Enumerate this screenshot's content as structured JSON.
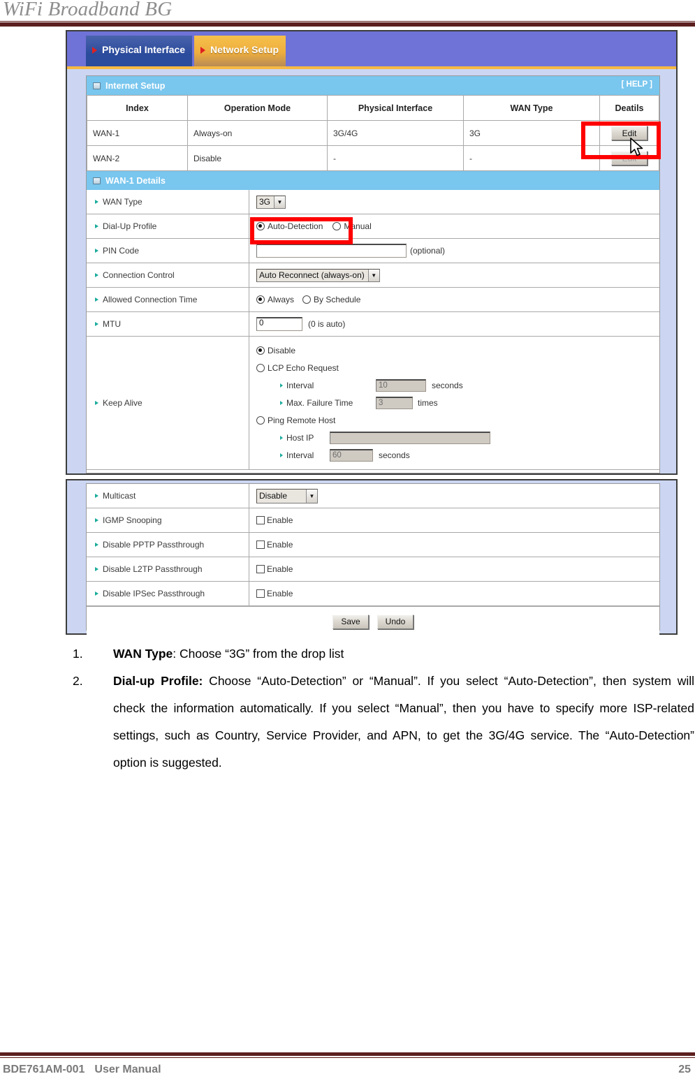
{
  "document": {
    "running_head": "WiFi Broadband BG",
    "footer": {
      "model": "BDE761AM-001",
      "doc_type": "User Manual",
      "page_number": "25"
    }
  },
  "router_ui": {
    "tabs": [
      {
        "label": "Physical Interface",
        "active": false
      },
      {
        "label": "Network Setup",
        "active": true
      }
    ],
    "internet_setup": {
      "section_title": "Internet Setup",
      "help_label": "[ HELP ]",
      "columns": [
        "Index",
        "Operation Mode",
        "Physical Interface",
        "WAN Type",
        "Deatils"
      ],
      "rows": [
        {
          "index": "WAN-1",
          "operation_mode": "Always-on",
          "physical_interface": "3G/4G",
          "wan_type": "3G",
          "details_button": "Edit",
          "details_enabled": true
        },
        {
          "index": "WAN-2",
          "operation_mode": "Disable",
          "physical_interface": "-",
          "wan_type": "-",
          "details_button": "Edit",
          "details_enabled": false
        }
      ]
    },
    "wan_details": {
      "section_title": "WAN-1 Details",
      "wan_type": {
        "label": "WAN Type",
        "selected": "3G"
      },
      "dial_up_profile": {
        "label": "Dial-Up Profile",
        "options": [
          "Auto-Detection",
          "Manual"
        ],
        "selected": "Auto-Detection"
      },
      "pin_code": {
        "label": "PIN Code",
        "value": "",
        "note": "(optional)"
      },
      "connection_control": {
        "label": "Connection Control",
        "selected": "Auto Reconnect (always-on)"
      },
      "allowed_connection_time": {
        "label": "Allowed Connection Time",
        "options": [
          "Always",
          "By Schedule"
        ],
        "selected": "Always"
      },
      "mtu": {
        "label": "MTU",
        "value": "0",
        "note": "(0 is auto)"
      },
      "keep_alive": {
        "label": "Keep Alive",
        "selected": "Disable",
        "options": [
          {
            "name": "Disable"
          },
          {
            "name": "LCP Echo Request"
          },
          {
            "name": "Ping Remote Host"
          }
        ],
        "lcp_interval": {
          "label": "Interval",
          "value": "10",
          "unit": "seconds"
        },
        "lcp_max_failure": {
          "label": "Max. Failure Time",
          "value": "3",
          "unit": "times"
        },
        "ping_host_ip": {
          "label": "Host IP",
          "value": ""
        },
        "ping_interval": {
          "label": "Interval",
          "value": "60",
          "unit": "seconds"
        }
      },
      "multicast": {
        "label": "Multicast",
        "selected": "Disable"
      },
      "igmp_snooping": {
        "label": "IGMP Snooping",
        "checkbox_label": "Enable",
        "checked": false
      },
      "disable_pptp": {
        "label": "Disable PPTP Passthrough",
        "checkbox_label": "Enable",
        "checked": false
      },
      "disable_l2tp": {
        "label": "Disable L2TP Passthrough",
        "checkbox_label": "Enable",
        "checked": false
      },
      "disable_ipsec": {
        "label": "Disable IPSec Passthrough",
        "checkbox_label": "Enable",
        "checked": false
      },
      "actions": {
        "save": "Save",
        "undo": "Undo"
      }
    },
    "colors": {
      "tab_bar": "#6f72d6",
      "tab_active": "#eeae3e",
      "tab_inactive": "#2b4b9c",
      "section_header": "#79c6ee",
      "panel_background": "#ccd6f2",
      "annotation": "#ff0000",
      "bullet": "#1aab9b"
    }
  },
  "instructions": [
    {
      "number": "1.",
      "term": "WAN Type",
      "text": ": Choose “3G” from the drop list"
    },
    {
      "number": "2.",
      "term": "Dial-up Profile:",
      "text": " Choose “Auto-Detection” or “Manual”. If you select “Auto-Detection”, then system will check the information automatically. If you select “Manual”, then you have to specify more ISP-related settings, such as Country, Service Provider, and APN, to get the 3G/4G service. The “Auto-Detection” option is suggested."
    }
  ]
}
